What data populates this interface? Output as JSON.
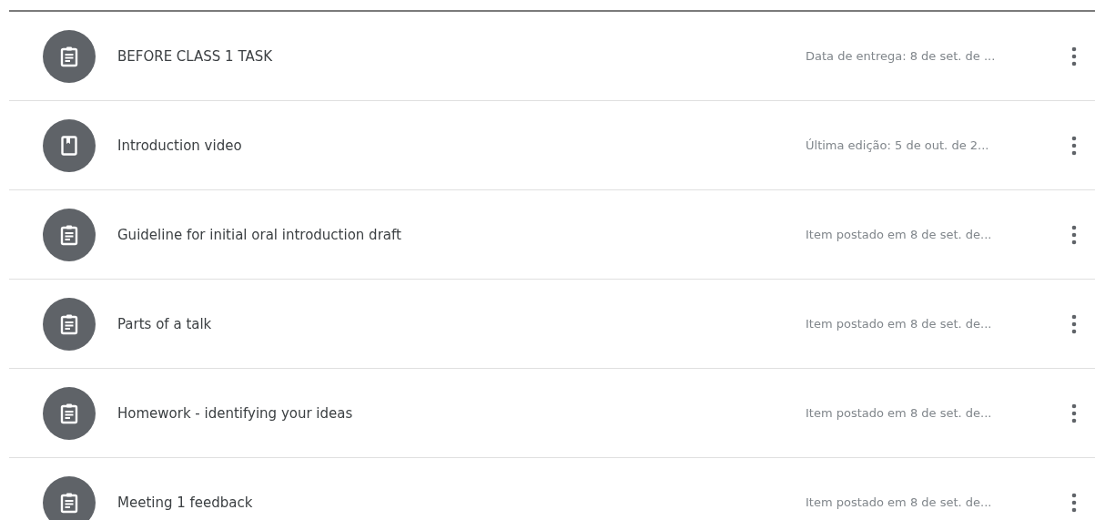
{
  "items": [
    {
      "kind": "assignment",
      "title": "BEFORE CLASS 1 TASK",
      "meta": "Data de entrega: 8 de set. de ..."
    },
    {
      "kind": "material",
      "title": "Introduction video",
      "meta": "Última edição: 5 de out. de 2..."
    },
    {
      "kind": "assignment",
      "title": "Guideline for initial oral introduction draft",
      "meta": "Item postado em 8 de set. de..."
    },
    {
      "kind": "assignment",
      "title": "Parts of a talk",
      "meta": "Item postado em 8 de set. de..."
    },
    {
      "kind": "assignment",
      "title": "Homework - identifying your ideas",
      "meta": "Item postado em 8 de set. de..."
    },
    {
      "kind": "assignment",
      "title": "Meeting 1 feedback",
      "meta": "Item postado em 8 de set. de..."
    }
  ]
}
